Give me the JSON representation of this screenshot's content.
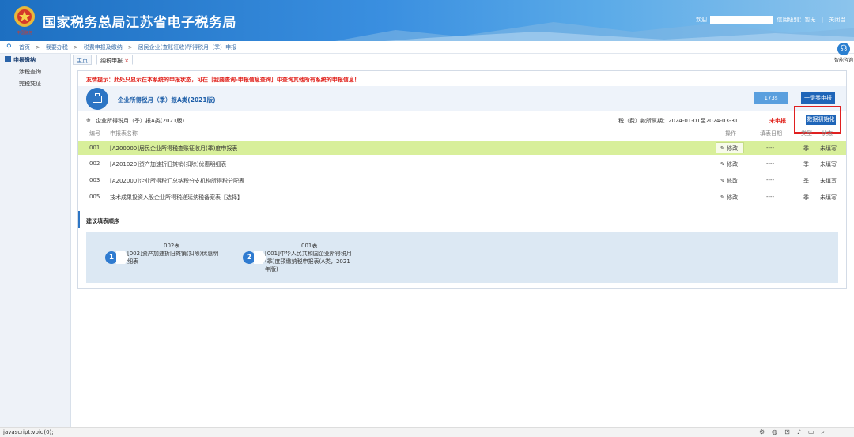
{
  "header": {
    "site_title": "国家税务总局江苏省电子税务局",
    "welcome": "欢迎",
    "credit_rating": "信用级别：暂无",
    "close_label": "关闭当",
    "emblem_text": "中国税务"
  },
  "breadcrumb": [
    "首页",
    "我要办税",
    "税费申报及缴纳",
    "居民企业(查账征收)所得税月（季）申报"
  ],
  "sidebar": {
    "title": "申报缴纳",
    "items": [
      "涉税查询",
      "完税凭证"
    ]
  },
  "tabs": [
    "主页",
    "纳税申报"
  ],
  "help_label": "智能咨询",
  "tip": "友情提示：此处只显示在本系统的申报状态，可在［我要查询-申报信息查询］中查询其他所有系统的申报信息！",
  "form": {
    "title": "企业所得税月（季）报A类(2021版)",
    "count_button": "173s",
    "zero_button": "一键零申报",
    "section_name": "企业所得税月（季）报A类(2021版)",
    "period": "税（费）款所属期：2024-01-01至2024-03-31",
    "status": "未申报",
    "init_button": "数据初始化"
  },
  "table": {
    "headers": {
      "num": "编号",
      "name": "申报表名称",
      "op": "操作",
      "date": "填表日期",
      "type": "类型",
      "state": "状态"
    },
    "rows": [
      {
        "num": "001",
        "name": "[A200000]居民企业所得税查账征收月(季)度申报表",
        "op": "修改",
        "date": "----",
        "type": "季",
        "state": "未填写"
      },
      {
        "num": "002",
        "name": "[A201020]资产加速折旧摊销(扣除)优惠明细表",
        "op": "修改",
        "date": "----",
        "type": "季",
        "state": "未填写"
      },
      {
        "num": "003",
        "name": "[A202000]企业所得税汇总纳税分支机构所得税分配表",
        "op": "修改",
        "date": "----",
        "type": "季",
        "state": "未填写"
      },
      {
        "num": "005",
        "name": "技术成果投资入股企业所得税递延纳税备案表【选择】",
        "op": "修改",
        "date": "----",
        "type": "季",
        "state": "未填写"
      }
    ]
  },
  "suggest": {
    "title": "建议填表顺序",
    "steps": [
      {
        "num": "1",
        "code": "002表",
        "desc": "[002]资产加速折旧摊销(扣除)优惠明细表"
      },
      {
        "num": "2",
        "code": "001表",
        "desc": "[001]中华人民共和国企业所得税月(季)度预缴纳税申报表(A类，2021年版)"
      }
    ]
  },
  "statusbar": {
    "text": "javascript:void(0);"
  },
  "colors": {
    "header_blue": "#1d6fc1",
    "highlight_row": "#d8ef9a",
    "warning_red": "#e0201a",
    "button_blue": "#1f65b8"
  }
}
